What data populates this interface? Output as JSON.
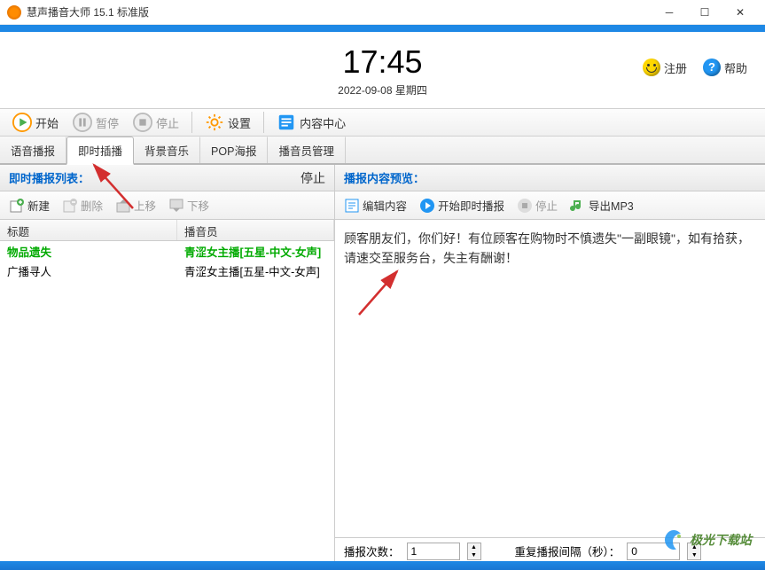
{
  "titlebar": {
    "text": "慧声播音大师 15.1 标准版"
  },
  "header": {
    "time": "17:45",
    "date": "2022-09-08 星期四",
    "register": "注册",
    "help": "帮助"
  },
  "ribbon": {
    "start": "开始",
    "pause": "暂停",
    "stop": "停止",
    "settings": "设置",
    "contentCenter": "内容中心"
  },
  "tabs": [
    "语音播报",
    "即时插播",
    "背景音乐",
    "POP海报",
    "播音员管理"
  ],
  "activeTab": 1,
  "leftPanel": {
    "title": "即时播报列表：",
    "stopLabel": "停止",
    "toolbar": {
      "new": "新建",
      "delete": "删除",
      "up": "上移",
      "down": "下移"
    },
    "columns": {
      "title": "标题",
      "announcer": "播音员"
    },
    "rows": [
      {
        "title": "物品遗失",
        "announcer": "青涩女主播[五星-中文-女声]",
        "selected": true
      },
      {
        "title": "广播寻人",
        "announcer": "青涩女主播[五星-中文-女声]",
        "selected": false
      }
    ]
  },
  "rightPanel": {
    "title": "播报内容预览：",
    "toolbar": {
      "edit": "编辑内容",
      "startBroadcast": "开始即时播报",
      "stop": "停止",
      "export": "导出MP3"
    },
    "preview": "顾客朋友们，你们好！有位顾客在购物时不慎遗失\"一副眼镜\"，如有拾获，请速交至服务台，失主有酬谢！",
    "footer": {
      "countLabel": "播报次数：",
      "countValue": "1",
      "intervalLabel": "重复播报间隔（秒）：",
      "intervalValue": "0"
    }
  },
  "watermark": "极光下载站"
}
